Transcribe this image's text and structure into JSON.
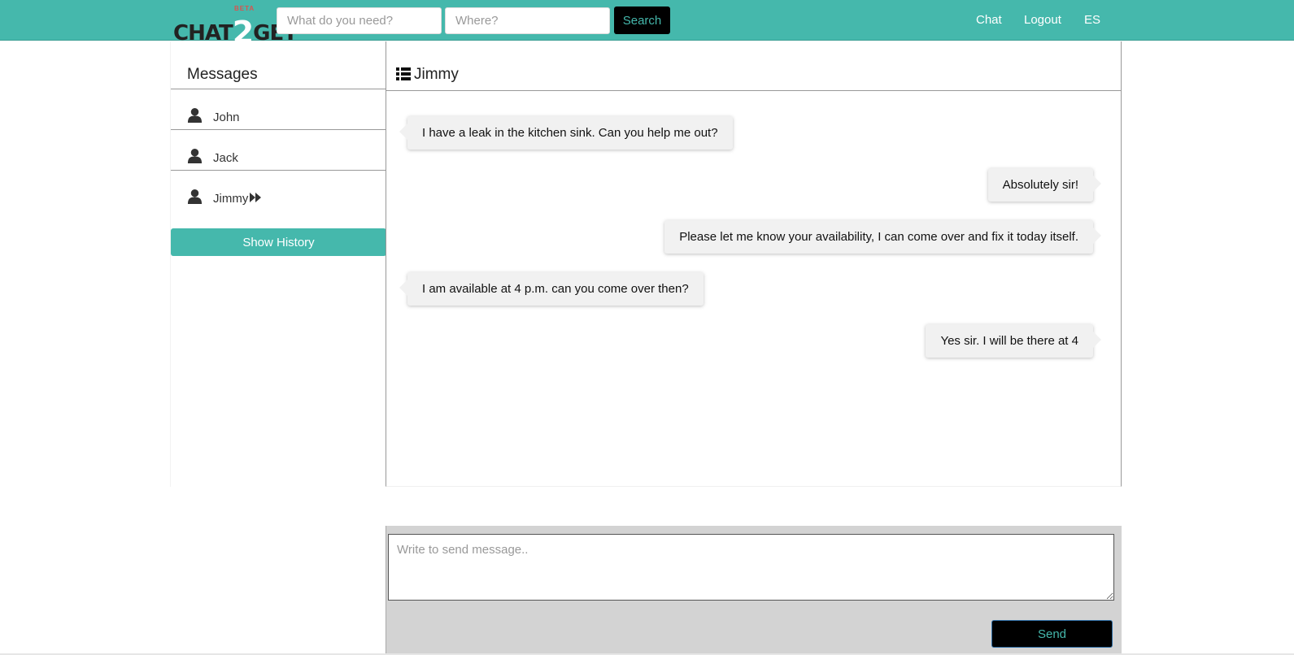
{
  "app": {
    "brand": "CHAT2GET",
    "brand_prefix": "CHAT",
    "brand_number": "2",
    "brand_suffix": "GET",
    "brand_tag": "BETA"
  },
  "header": {
    "search_what_placeholder": "What do you need?",
    "search_where_placeholder": "Where?",
    "search_label": "Search",
    "nav": {
      "chat": "Chat",
      "logout": "Logout",
      "language": "ES"
    }
  },
  "sidebar": {
    "title": "Messages",
    "contacts": [
      {
        "name": "John",
        "icon": "person-icon"
      },
      {
        "name": "Jack",
        "icon": "person-icon"
      },
      {
        "name": "Jimmy",
        "icon": "person-icon",
        "active": true,
        "active_icon": "forward-icon"
      }
    ],
    "history_label": "Show History"
  },
  "chat": {
    "title": "Jimmy",
    "title_icon": "list-icon",
    "messages": [
      {
        "side": "left",
        "text": "I have a leak in the kitchen sink. Can you help me out?"
      },
      {
        "side": "right",
        "text": "Absolutely sir!"
      },
      {
        "side": "right",
        "text": "Please let me know your availability, I can come over and fix it today itself."
      },
      {
        "side": "left",
        "text": "I am available at 4 p.m. can you come over then?"
      },
      {
        "side": "right",
        "text": "Yes sir. I will be there at 4"
      }
    ]
  },
  "compose": {
    "placeholder": "Write to send message..",
    "send_label": "Send"
  },
  "colors": {
    "accent": "#45b8ac",
    "button_dark": "#000000",
    "bubble": "#f1f1f1",
    "brand_tag": "#d9534f"
  }
}
